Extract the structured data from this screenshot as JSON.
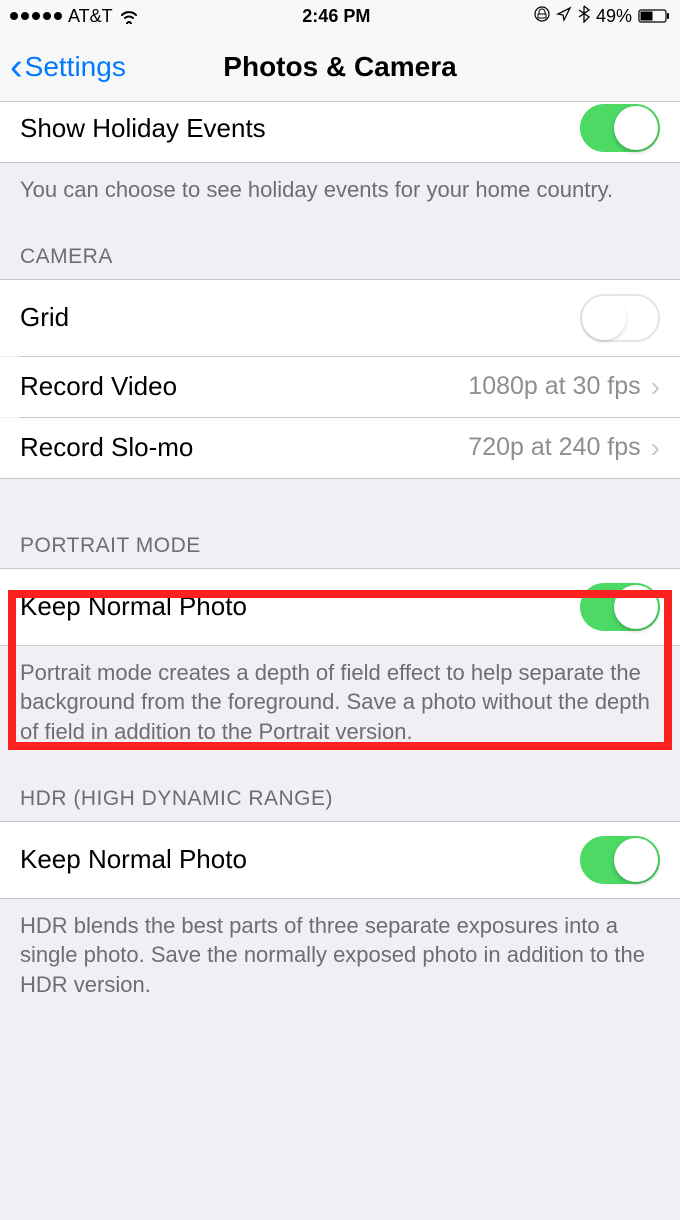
{
  "status": {
    "carrier": "AT&T",
    "time": "2:46 PM",
    "battery_percent": "49%"
  },
  "nav": {
    "back_label": "Settings",
    "title": "Photos & Camera"
  },
  "holiday": {
    "label": "Show Holiday Events",
    "footer": "You can choose to see holiday events for your home country."
  },
  "camera": {
    "header": "CAMERA",
    "grid_label": "Grid",
    "video_label": "Record Video",
    "video_value": "1080p at 30 fps",
    "slomo_label": "Record Slo-mo",
    "slomo_value": "720p at 240 fps"
  },
  "portrait": {
    "header": "PORTRAIT MODE",
    "keep_label": "Keep Normal Photo",
    "footer": "Portrait mode creates a depth of field effect to help separate the background from the foreground. Save a photo without the depth of field in addition to the Portrait version."
  },
  "hdr": {
    "header": "HDR (HIGH DYNAMIC RANGE)",
    "keep_label": "Keep Normal Photo",
    "footer": "HDR blends the best parts of three separate exposures into a single photo. Save the normally exposed photo in addition to the HDR version."
  }
}
